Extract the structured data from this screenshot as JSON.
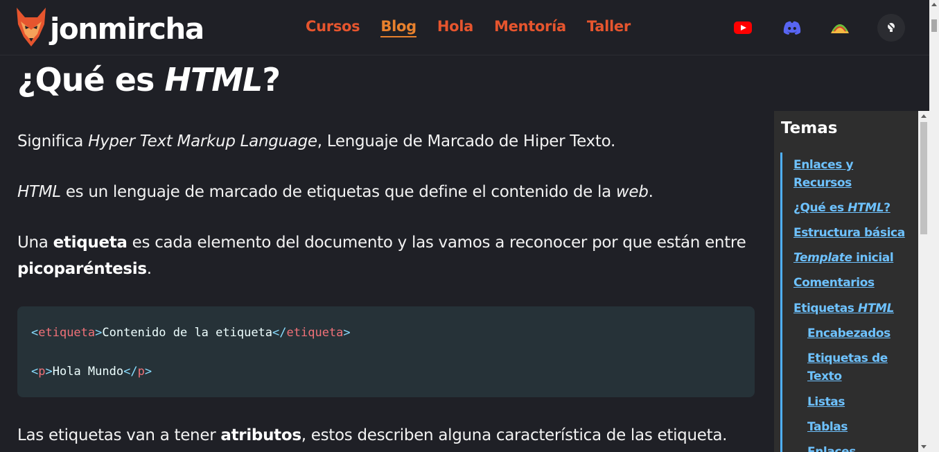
{
  "header": {
    "logo_text": "jonmircha",
    "nav": [
      {
        "label": "Cursos",
        "active": false
      },
      {
        "label": "Blog",
        "active": true
      },
      {
        "label": "Hola",
        "active": false
      },
      {
        "label": "Mentoría",
        "active": false
      },
      {
        "label": "Taller",
        "active": false
      }
    ],
    "icons": [
      "youtube-icon",
      "discord-icon",
      "taco-icon",
      "theme-toggle-icon"
    ]
  },
  "main": {
    "title_prefix": "¿Qué es ",
    "title_em": "HTML",
    "title_suffix": "?",
    "p1": {
      "a": "Significa ",
      "em": "Hyper Text Markup Language",
      "b": ", Lenguaje de Marcado de Hiper Texto."
    },
    "p2": {
      "em1": "HTML",
      "a": " es un lenguaje de marcado de etiquetas que define el contenido de la ",
      "em2": "web",
      "b": "."
    },
    "p3": {
      "a": "Una ",
      "strong1": "etiqueta",
      "b": " es cada elemento del documento y las vamos a reconocer por que están entre ",
      "strong2": "picoparéntesis",
      "c": "."
    },
    "code": {
      "line1": {
        "open_lt": "<",
        "open_tag": "etiqueta",
        "open_gt": ">",
        "text": "Contenido de la etiqueta",
        "close_lt": "</",
        "close_tag": "etiqueta",
        "close_gt": ">"
      },
      "line2": {
        "open_lt": "<",
        "open_tag": "p",
        "open_gt": ">",
        "text": "Hola Mundo",
        "close_lt": "</",
        "close_tag": "p",
        "close_gt": ">"
      }
    },
    "p4": {
      "a": "Las etiquetas van a tener ",
      "strong": "atributos",
      "b": ", estos describen alguna característica de las etiqueta."
    }
  },
  "toc": {
    "title": "Temas",
    "items": [
      {
        "line1": "Enlaces y",
        "line2": "Recursos"
      },
      {
        "a": "¿Qué es ",
        "em": "HTML",
        "b": "?"
      },
      {
        "label": "Estructura básica"
      },
      {
        "em": "Template",
        "b": " inicial"
      },
      {
        "label": "Comentarios"
      },
      {
        "a": "Etiquetas ",
        "em": "HTML"
      },
      {
        "label": "Encabezados"
      },
      {
        "line1": "Etiquetas de",
        "line2": "Texto"
      },
      {
        "label": "Listas"
      },
      {
        "label": "Tablas"
      },
      {
        "label": "Enlaces"
      }
    ]
  },
  "colors": {
    "background": "#1f2026",
    "nav": "#e6552e",
    "nav_active": "#e8812d",
    "toc_link": "#6ec2ff",
    "code_bg": "#263238",
    "code_tag": "#f07178",
    "code_punct": "#89ddff"
  }
}
